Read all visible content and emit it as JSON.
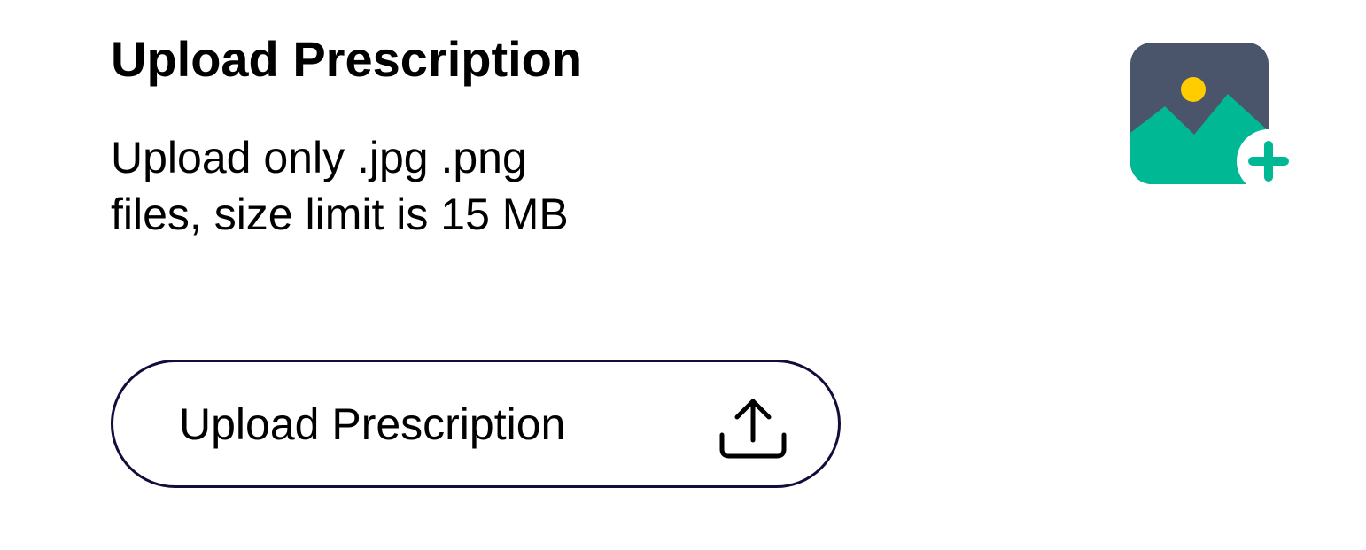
{
  "header": {
    "title": "Upload Prescription"
  },
  "info": {
    "line1": "Upload only .jpg .png",
    "line2": "files, size limit is 15 MB"
  },
  "upload_button": {
    "label": "Upload Prescription",
    "icon": "upload-icon"
  },
  "illustration": {
    "icon": "image-add-icon"
  },
  "colors": {
    "button_border": "#120d3a",
    "icon_frame": "#4a556c",
    "icon_mountain": "#00b894",
    "icon_sun": "#ffcc00"
  }
}
